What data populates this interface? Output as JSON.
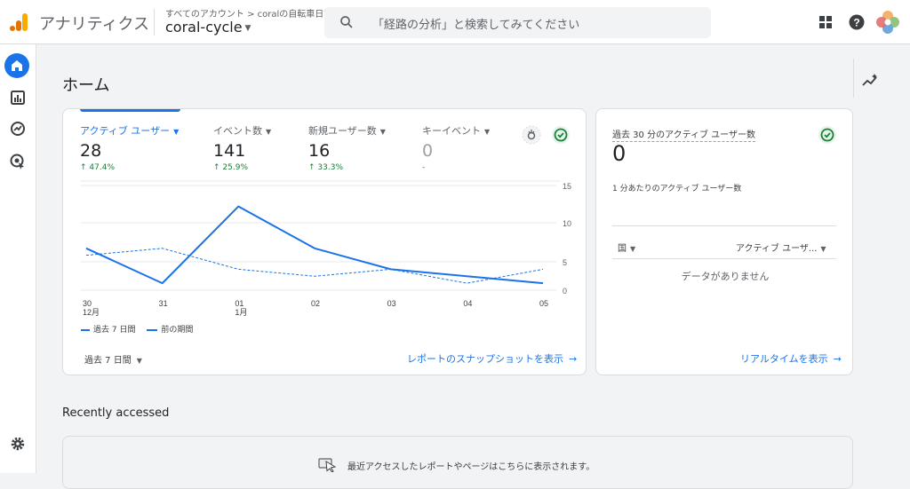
{
  "app": {
    "title": "アナリティクス",
    "breadcrumb": "すべてのアカウント > coralの自転車日記",
    "property": "coral-cycle",
    "search_placeholder": "「経路の分析」と検索してみてください"
  },
  "colors": {
    "accent": "#1a73e8",
    "positive": "#188038",
    "logo_orange": "#f9ab00",
    "logo_dark": "#e37400"
  },
  "icons": {
    "apps": "apps-grid-icon",
    "help": "help-icon",
    "avatar": "account-avatar-icon",
    "search": "search-icon"
  },
  "nav": [
    "home-icon",
    "reports-icon",
    "explore-icon",
    "advertising-icon",
    "settings-icon"
  ],
  "page": {
    "title": "ホーム"
  },
  "metrics": [
    {
      "label": "アクティブ ユーザー",
      "value": "28",
      "delta": "↑ 47.4%"
    },
    {
      "label": "イベント数",
      "value": "141",
      "delta": "↑ 25.9%"
    },
    {
      "label": "新規ユーザー数",
      "value": "16",
      "delta": "↑ 33.3%"
    },
    {
      "label": "キーイベント",
      "value": "0",
      "delta": "-"
    }
  ],
  "chart_data": {
    "type": "line",
    "x": [
      "30 12月",
      "31",
      "01 1月",
      "02",
      "03",
      "04",
      "05"
    ],
    "x_ticks": [
      [
        "30",
        "12月"
      ],
      [
        "31",
        ""
      ],
      [
        "01",
        "1月"
      ],
      [
        "02",
        ""
      ],
      [
        "03",
        ""
      ],
      [
        "04",
        ""
      ],
      [
        "05",
        ""
      ]
    ],
    "y_ticks": [
      "15",
      "10",
      "5",
      "0"
    ],
    "ylim": [
      0,
      15
    ],
    "series": [
      {
        "name": "過去 7 日間",
        "style": "solid",
        "values": [
          6,
          1,
          12,
          6,
          3,
          2,
          1
        ]
      },
      {
        "name": "前の期間",
        "style": "dashed",
        "values": [
          5,
          6,
          3,
          2,
          3,
          1,
          3
        ]
      }
    ]
  },
  "legend": {
    "current": "過去 7 日間",
    "previous": "前の期間"
  },
  "range_select": "過去 7 日間",
  "snapshot_link": "レポートのスナップショットを表示",
  "realtime": {
    "title": "過去 30 分のアクティブ ユーザー数",
    "value": "0",
    "subtitle": "1 分あたりのアクティブ ユーザー数",
    "col_country": "国",
    "col_users": "アクティブ ユーザ...",
    "empty": "データがありません",
    "link": "リアルタイムを表示"
  },
  "recent": {
    "title": "Recently accessed",
    "empty": "最近アクセスしたレポートやページはこちらに表示されます。"
  }
}
